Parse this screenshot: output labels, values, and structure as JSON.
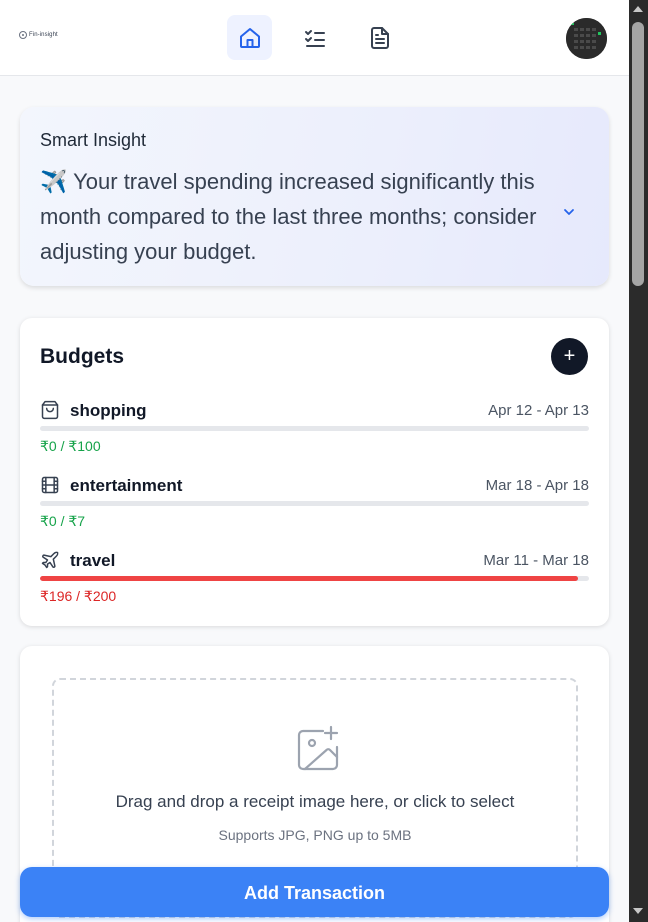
{
  "header": {
    "logo_text": "Fin-insight",
    "nav": [
      {
        "icon": "home-icon",
        "active": true
      },
      {
        "icon": "checklist-icon",
        "active": false
      },
      {
        "icon": "document-icon",
        "active": false
      }
    ],
    "avatar": "avatar"
  },
  "insight": {
    "title": "Smart Insight",
    "emoji": "✈️",
    "text": "Your travel spending increased significantly this month compared to the last three months; consider adjusting your budget."
  },
  "budgets": {
    "title": "Budgets",
    "add_label": "+",
    "items": [
      {
        "icon": "shopping-bag-icon",
        "name": "shopping",
        "dates": "Apr 12 - Apr 13",
        "amount": "₹0 / ₹100",
        "progress": 0,
        "color": "#16a34a"
      },
      {
        "icon": "film-icon",
        "name": "entertainment",
        "dates": "Mar 18 - Apr 18",
        "amount": "₹0 / ₹7",
        "progress": 0,
        "color": "#16a34a"
      },
      {
        "icon": "plane-icon",
        "name": "travel",
        "dates": "Mar 11 - Mar 18",
        "amount": "₹196 / ₹200",
        "progress": 0.98,
        "color": "#dc2626"
      }
    ]
  },
  "upload": {
    "icon": "image-plus-icon",
    "text": "Drag and drop a receipt image here, or click to select",
    "subtext": "Supports JPG, PNG up to 5MB"
  },
  "submit_label": "Add Transaction",
  "colors": {
    "accent": "#3b82f6",
    "danger": "#ef4444",
    "success": "#16a34a"
  }
}
